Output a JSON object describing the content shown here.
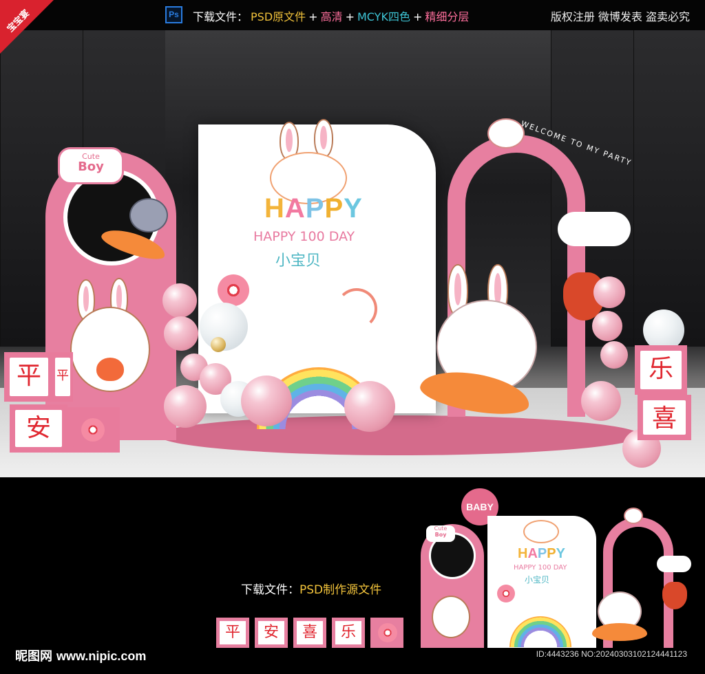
{
  "corner": {
    "label": "宝宝宴"
  },
  "topbar": {
    "ps_badge": "Ps",
    "prefix": "下载文件：",
    "items": [
      {
        "text": "PSD原文件"
      },
      {
        "text": "+"
      },
      {
        "text": "高清"
      },
      {
        "text": "+"
      },
      {
        "text": "MCYK四色"
      },
      {
        "text": "+"
      },
      {
        "text": "精细分层"
      }
    ],
    "right": "版权注册 微博发表 盗卖必究",
    "colors": {
      "yellow": "#f2c33b",
      "pink": "#ff6f9d",
      "cyan": "#3ec5d6"
    }
  },
  "scene": {
    "baby_circle": "BABY",
    "cute_boy_top": "Cute",
    "cute_boy_bottom": "Boy",
    "happy_letters": [
      "H",
      "A",
      "P",
      "P",
      "Y"
    ],
    "subtitle": "HAPPY 100 DAY",
    "chinese_title": "小宝贝",
    "arch_text": "WELCOME TO MY PARTY",
    "blocks": {
      "left_top_a": "平",
      "left_top_b": "平",
      "left_bottom": "安",
      "right_top": "乐",
      "right_bottom": "喜",
      "right_side_a": "乐",
      "right_side_b": "喜"
    },
    "brand_color": "#e77fa0"
  },
  "bottom": {
    "download_prefix": "下载文件：",
    "download_file": "PSD制作源文件",
    "tiles": [
      "平",
      "安",
      "喜",
      "乐"
    ],
    "mini_baby": "BABY",
    "mini_happy_letters": [
      "H",
      "A",
      "P",
      "P",
      "Y"
    ],
    "mini_subtitle": "HAPPY 100 DAY",
    "mini_chinese_title": "小宝贝",
    "mini_cute": "Cute",
    "mini_boy": "Boy",
    "mini_arch_text": "WELCOME TO MY PARTY",
    "logo_text": "昵图网",
    "logo_url": "www.nipic.com",
    "id_line": "ID:4443236 NO:20240303102124441123"
  }
}
